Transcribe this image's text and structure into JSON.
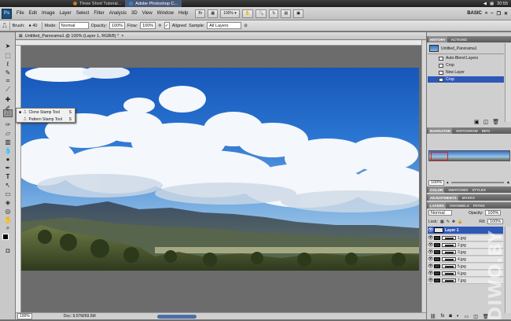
{
  "taskbar": {
    "tabs": [
      {
        "label": "Three Short Tutorial..."
      },
      {
        "label": "Adobe Photoshop C..."
      }
    ],
    "clock": "20:55"
  },
  "menubar": {
    "logo": "Ps",
    "items": [
      "File",
      "Edit",
      "Image",
      "Layer",
      "Select",
      "Filter",
      "Analysis",
      "3D",
      "View",
      "Window",
      "Help"
    ],
    "zoom": "100%",
    "workspace": "BASIC"
  },
  "options": {
    "brush_label": "Brush:",
    "brush_size": "40",
    "mode_label": "Mode:",
    "mode_value": "Normal",
    "opacity_label": "Opacity:",
    "opacity_value": "100%",
    "flow_label": "Flow:",
    "flow_value": "100%",
    "aligned_label": "Aligned",
    "sample_label": "Sample:",
    "sample_value": "All Layers"
  },
  "document": {
    "tab_title": "Untitled_Panorama1 @ 100% (Layer 1, RGB/8) *",
    "status_zoom": "100%",
    "status_doc": "Doc: 9.07M/69.6M"
  },
  "flyout": {
    "items": [
      {
        "label": "Clone Stamp Tool",
        "shortcut": "S"
      },
      {
        "label": "Pattern Stamp Tool",
        "shortcut": "S"
      }
    ]
  },
  "history": {
    "tabs": [
      "HISTORY",
      "ACTIONS"
    ],
    "snapshot": "Untitled_Panorama1",
    "items": [
      "Auto-Blend Layers",
      "Crop",
      "New Layer",
      "Crop"
    ]
  },
  "navigator": {
    "tabs": [
      "NAVIGATOR",
      "HISTOGRAM",
      "INFO"
    ],
    "zoom": "100%"
  },
  "color_panel": {
    "tabs": [
      "COLOR",
      "SWATCHES",
      "STYLES"
    ]
  },
  "adjustments": {
    "tabs": [
      "ADJUSTMENTS",
      "MASKS"
    ]
  },
  "layers": {
    "tabs": [
      "LAYERS",
      "CHANNELS",
      "PATHS"
    ],
    "blend_mode": "Normal",
    "opacity_label": "Opacity:",
    "opacity_value": "100%",
    "lock_label": "Lock:",
    "fill_label": "Fill:",
    "fill_value": "100%",
    "items": [
      "Layer 1",
      "1.jpg",
      "2.jpg",
      "3.jpg",
      "4.jpg",
      "5.jpg",
      "6.jpg",
      "7.jpg"
    ]
  },
  "watermark": "DIWO.BY",
  "colors": {
    "selection": "#2e58b8",
    "sky": "#2f7ad6"
  }
}
